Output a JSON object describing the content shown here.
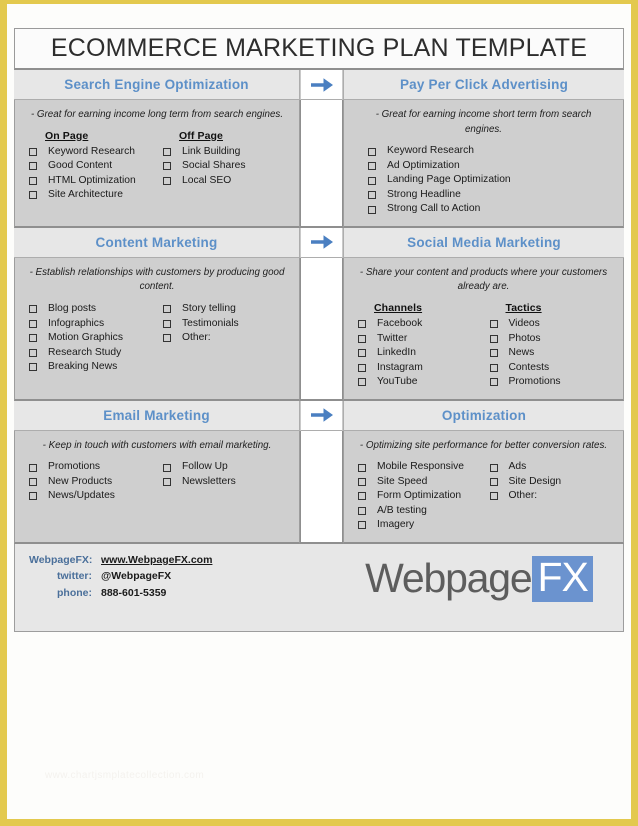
{
  "document": {
    "title": "ECOMMERCE MARKETING PLAN TEMPLATE",
    "watermark": "www.chartjsmplatecollection.com",
    "accent_blue": "#5d90c8",
    "logo_blue": "#6b93cf",
    "body_gray": "#cfcfcf",
    "header_gray": "#e7e7e7",
    "page_border": "#e3c94e"
  },
  "arrow": {
    "name": "arrow-right-icon",
    "glyph": "→"
  },
  "sections": [
    {
      "id": "seo",
      "title": "Search Engine Optimization",
      "description": "- Great for earning income long term from search engines.",
      "columns": [
        {
          "heading": "On Page",
          "items": [
            "Keyword Research",
            "Good Content",
            "HTML Optimization",
            "Site Architecture"
          ]
        },
        {
          "heading": "Off Page",
          "items": [
            "Link Building",
            "Social Shares",
            "Local SEO"
          ]
        }
      ]
    },
    {
      "id": "ppc",
      "title": "Pay Per Click Advertising",
      "description": "- Great for earning income short term from search engines.",
      "columns": [
        {
          "heading": "",
          "items": [
            "Keyword Research",
            "Ad Optimization",
            "Landing Page Optimization",
            "Strong Headline",
            "Strong Call to Action"
          ]
        }
      ]
    },
    {
      "id": "content",
      "title": "Content Marketing",
      "description": "- Establish relationships with customers by producing good content.",
      "columns": [
        {
          "heading": "",
          "items": [
            "Blog posts",
            "Infographics",
            "Motion Graphics",
            "Research Study",
            "Breaking News"
          ]
        },
        {
          "heading": "",
          "items": [
            "Story telling",
            "Testimonials",
            "Other:"
          ]
        }
      ]
    },
    {
      "id": "social",
      "title": "Social Media Marketing",
      "description": "- Share your content and products where your customers already are.",
      "columns": [
        {
          "heading": "Channels",
          "items": [
            "Facebook",
            "Twitter",
            "LinkedIn",
            "Instagram",
            "YouTube"
          ]
        },
        {
          "heading": "Tactics",
          "items": [
            "Videos",
            "Photos",
            "News",
            "Contests",
            "Promotions"
          ]
        }
      ]
    },
    {
      "id": "email",
      "title": "Email Marketing",
      "description": "- Keep in touch with customers with email marketing.",
      "columns": [
        {
          "heading": "",
          "items": [
            "Promotions",
            "New Products",
            "News/Updates"
          ]
        },
        {
          "heading": "",
          "items": [
            "Follow Up",
            "Newsletters"
          ]
        }
      ]
    },
    {
      "id": "optimization",
      "title": "Optimization",
      "description": "- Optimizing site performance for better conversion rates.",
      "columns": [
        {
          "heading": "",
          "items": [
            "Mobile Responsive",
            "Site Speed",
            "Form Optimization",
            "A/B testing",
            "Imagery"
          ]
        },
        {
          "heading": "",
          "items": [
            "Ads",
            "Site Design",
            "Other:"
          ]
        }
      ]
    }
  ],
  "footer": {
    "contacts": [
      {
        "key": "WebpageFX:",
        "value": "www.WebpageFX.com",
        "link": true
      },
      {
        "key": "twitter:",
        "value": "@WebpageFX",
        "link": false
      },
      {
        "key": "phone:",
        "value": "888-601-5359",
        "link": false
      }
    ],
    "logo": {
      "part1": "Webpage",
      "part2": "FX"
    }
  }
}
